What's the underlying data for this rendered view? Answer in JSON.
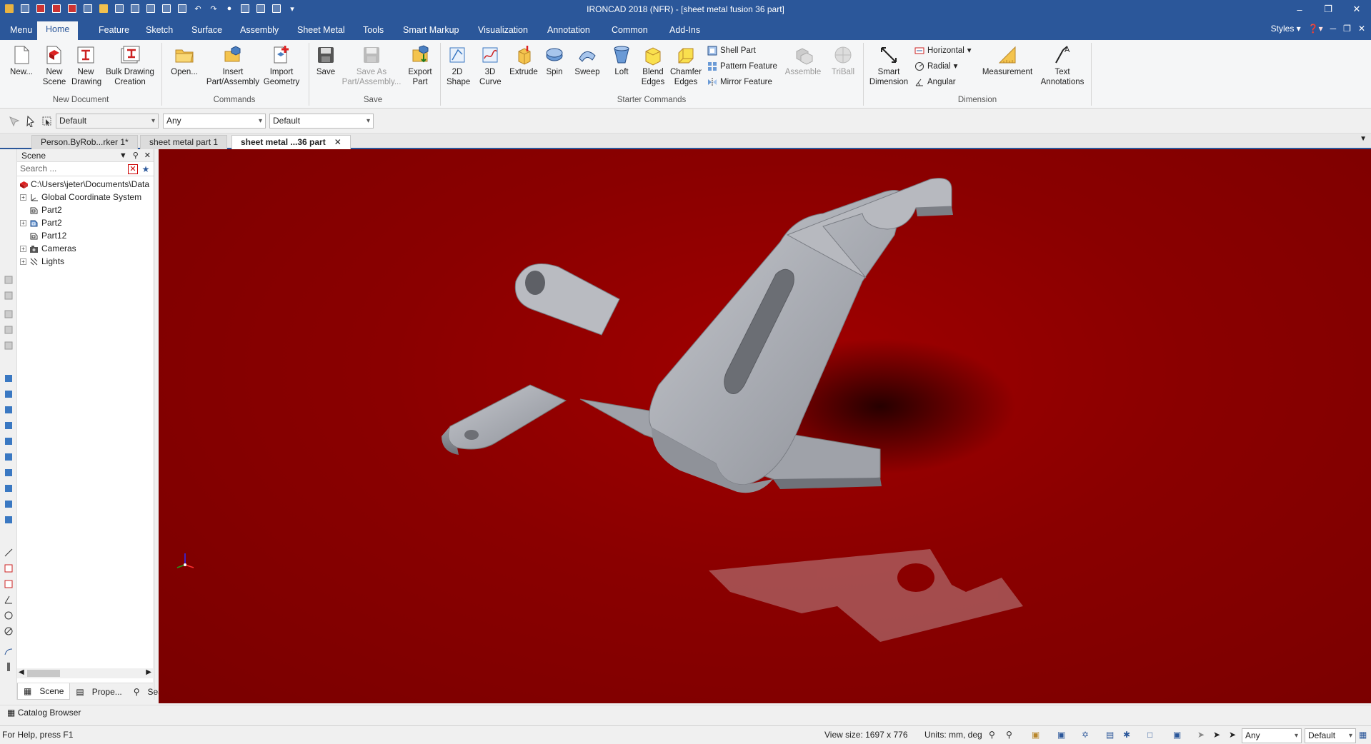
{
  "app": {
    "title": "IRONCAD 2018 (NFR) - [sheet metal fusion 36 part]"
  },
  "window_controls": [
    "–",
    "❐",
    "✕"
  ],
  "menu_tabs": [
    {
      "label": "Menu"
    },
    {
      "label": "Home",
      "active": true
    },
    {
      "label": "Feature"
    },
    {
      "label": "Sketch"
    },
    {
      "label": "Surface"
    },
    {
      "label": "Assembly"
    },
    {
      "label": "Sheet Metal"
    },
    {
      "label": "Tools"
    },
    {
      "label": "Smart Markup"
    },
    {
      "label": "Visualization"
    },
    {
      "label": "Annotation"
    },
    {
      "label": "Common"
    },
    {
      "label": "Add-Ins"
    }
  ],
  "styles_label": "Styles",
  "ribbon": {
    "new_document": {
      "label": "New Document",
      "buttons": [
        "New...",
        "New Scene",
        "New Drawing",
        "Bulk Drawing Creation"
      ]
    },
    "commands": {
      "label": "Commands",
      "buttons": [
        "Open...",
        "Insert Part/Assembly",
        "Import Geometry"
      ]
    },
    "save": {
      "label": "Save",
      "buttons": [
        "Save",
        "Save As Part/Assembly...",
        "Export Part"
      ]
    },
    "starter": {
      "label": "Starter Commands",
      "buttons": [
        "2D Shape",
        "3D Curve",
        "Extrude",
        "Spin",
        "Sweep",
        "Loft",
        "Blend Edges",
        "Chamfer Edges"
      ],
      "small": [
        "Shell Part",
        "Pattern Feature",
        "Mirror Feature"
      ],
      "disabled": [
        "Assemble",
        "TriBall"
      ]
    },
    "dimension": {
      "label": "Dimension",
      "buttons": [
        "Smart Dimension",
        "Measurement",
        "Text Annotations"
      ],
      "small": [
        "Horizontal",
        "Radial",
        "Angular"
      ]
    }
  },
  "filter_bar": {
    "style": "Default",
    "selection": "Any",
    "scheme": "Default"
  },
  "doc_tabs": [
    {
      "label": "Person.ByRob...rker 1*"
    },
    {
      "label": "sheet metal part 1"
    },
    {
      "label": "sheet metal ...36 part",
      "active": true
    }
  ],
  "scene_panel": {
    "title": "Scene",
    "search_placeholder": "Search ...",
    "tree": [
      {
        "label": "C:\\Users\\jeter\\Documents\\Data",
        "level": 0,
        "expander": false,
        "icon": "scene-icon"
      },
      {
        "label": "Global Coordinate System",
        "level": 1,
        "expander": true,
        "icon": "coordinate-system-icon"
      },
      {
        "label": "Part2",
        "level": 1,
        "expander": false,
        "icon": "part-icon"
      },
      {
        "label": "Part2",
        "level": 1,
        "expander": true,
        "icon": "part-blue-icon"
      },
      {
        "label": "Part12",
        "level": 1,
        "expander": false,
        "icon": "part-icon"
      },
      {
        "label": "Cameras",
        "level": 1,
        "expander": true,
        "icon": "camera-icon"
      },
      {
        "label": "Lights",
        "level": 1,
        "expander": true,
        "icon": "light-icon"
      }
    ],
    "bottom_tabs": [
      {
        "label": "Scene",
        "active": true
      },
      {
        "label": "Prope..."
      },
      {
        "label": "Search"
      }
    ]
  },
  "catalog_browser": "Catalog Browser",
  "status": {
    "help": "For Help, press F1",
    "view_size": "View size: 1697 x  776",
    "units": "Units: mm, deg",
    "selection": "Any",
    "scheme": "Default"
  },
  "colors": {
    "accent": "#2b579a",
    "viewport": "#8a0000",
    "part": "#a9acb3"
  }
}
